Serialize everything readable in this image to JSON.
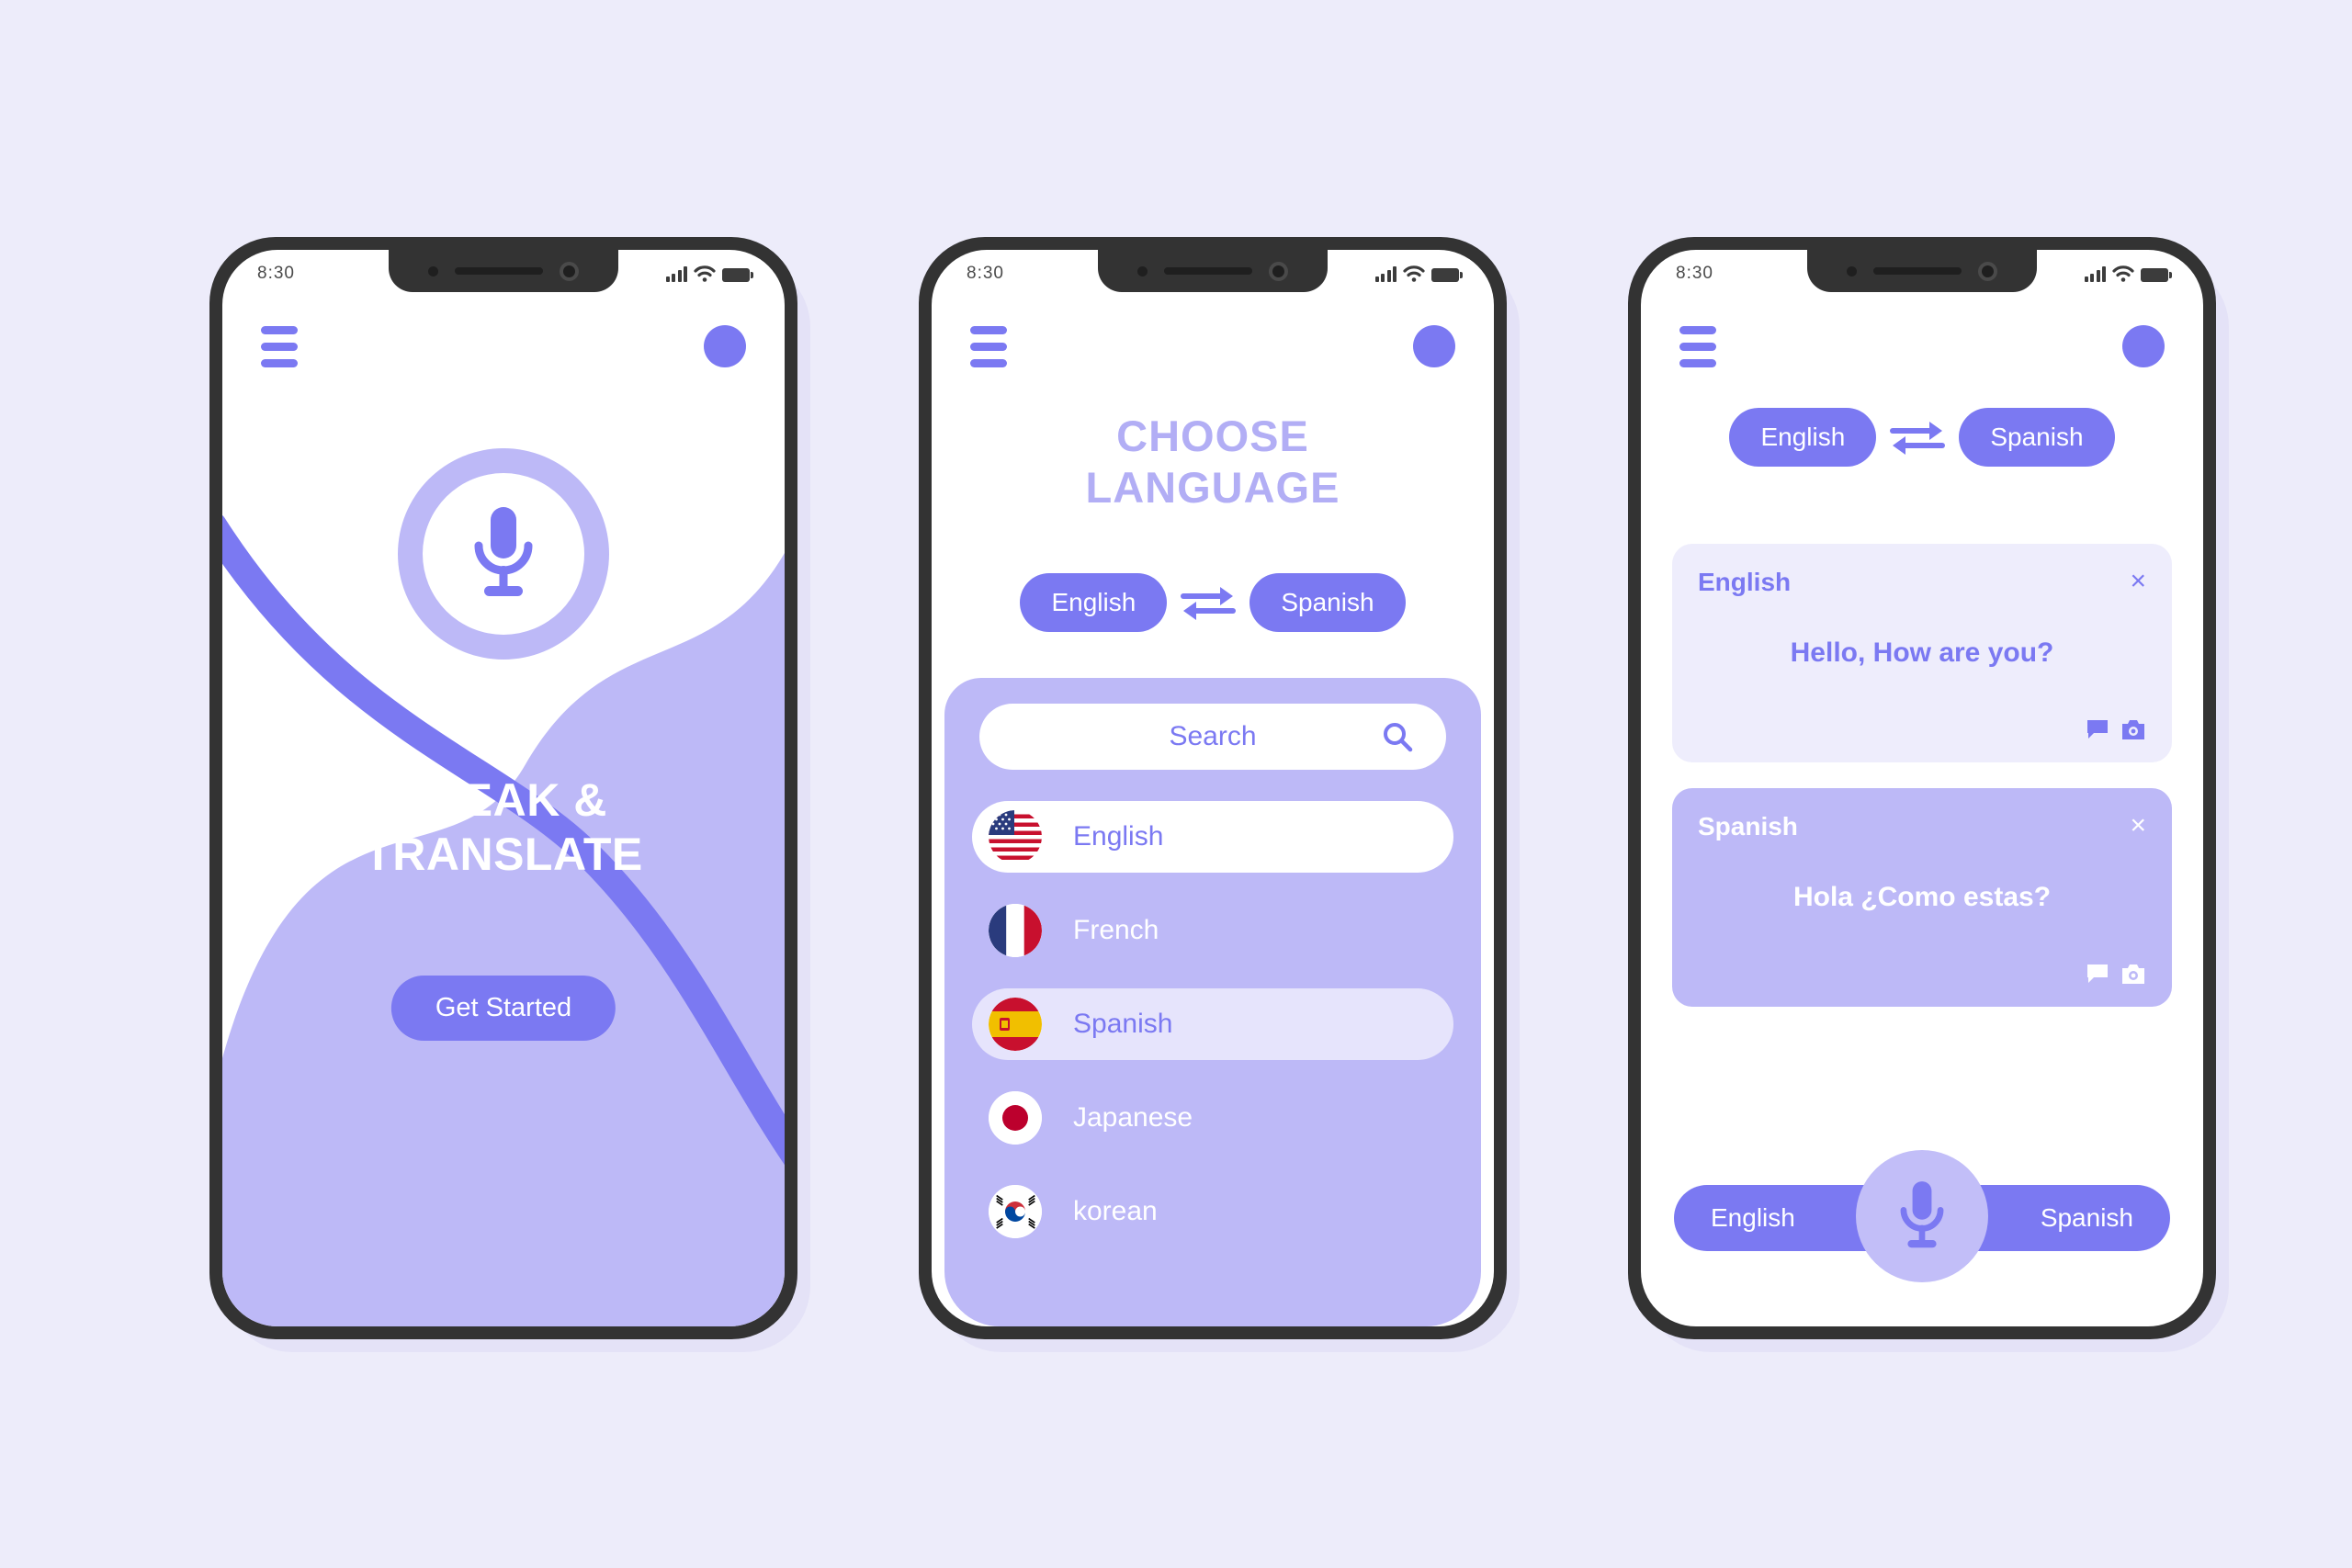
{
  "theme": {
    "background": "#edecfa",
    "primary": "#7b79f2",
    "primary_light": "#bdb9f7",
    "primary_pale": "#eeedfc",
    "frame": "#333333",
    "title_muted": "#b2aef5"
  },
  "status_bar": {
    "time": "8:30",
    "signal_icon": "signal-bars-icon",
    "wifi_icon": "wifi-icon",
    "battery_icon": "battery-icon"
  },
  "screen1": {
    "menu_icon": "hamburger-menu-icon",
    "avatar_icon": "avatar-icon",
    "mic_icon": "microphone-icon",
    "title_line1": "SPEAK &",
    "title_line2": "TRANSLATE",
    "cta_label": "Get Started"
  },
  "screen2": {
    "menu_icon": "hamburger-menu-icon",
    "avatar_icon": "avatar-icon",
    "title_line1": "CHOOSE",
    "title_line2": "LANGUAGE",
    "source_language": "English",
    "target_language": "Spanish",
    "swap_icon": "swap-arrows-icon",
    "search": {
      "placeholder": "Search",
      "icon": "search-icon"
    },
    "languages": [
      {
        "name": "English",
        "flag": "flag-us",
        "state": "selected"
      },
      {
        "name": "French",
        "flag": "flag-fr",
        "state": "normal"
      },
      {
        "name": "Spanish",
        "flag": "flag-es",
        "state": "highlighted"
      },
      {
        "name": "Japanese",
        "flag": "flag-jp",
        "state": "normal"
      },
      {
        "name": "korean",
        "flag": "flag-kr",
        "state": "normal"
      }
    ]
  },
  "screen3": {
    "menu_icon": "hamburger-menu-icon",
    "avatar_icon": "avatar-icon",
    "source_language": "English",
    "target_language": "Spanish",
    "swap_icon": "swap-arrows-icon",
    "cards": [
      {
        "language": "English",
        "text": "Hello, How are you?",
        "close_label": "×",
        "chat_icon": "chat-bubble-icon",
        "camera_icon": "camera-icon"
      },
      {
        "language": "Spanish",
        "text": "Hola ¿Como estas?",
        "close_label": "×",
        "chat_icon": "chat-bubble-icon",
        "camera_icon": "camera-icon"
      }
    ],
    "bottom_bar": {
      "left_label": "English",
      "right_label": "Spanish",
      "mic_icon": "microphone-icon"
    }
  }
}
